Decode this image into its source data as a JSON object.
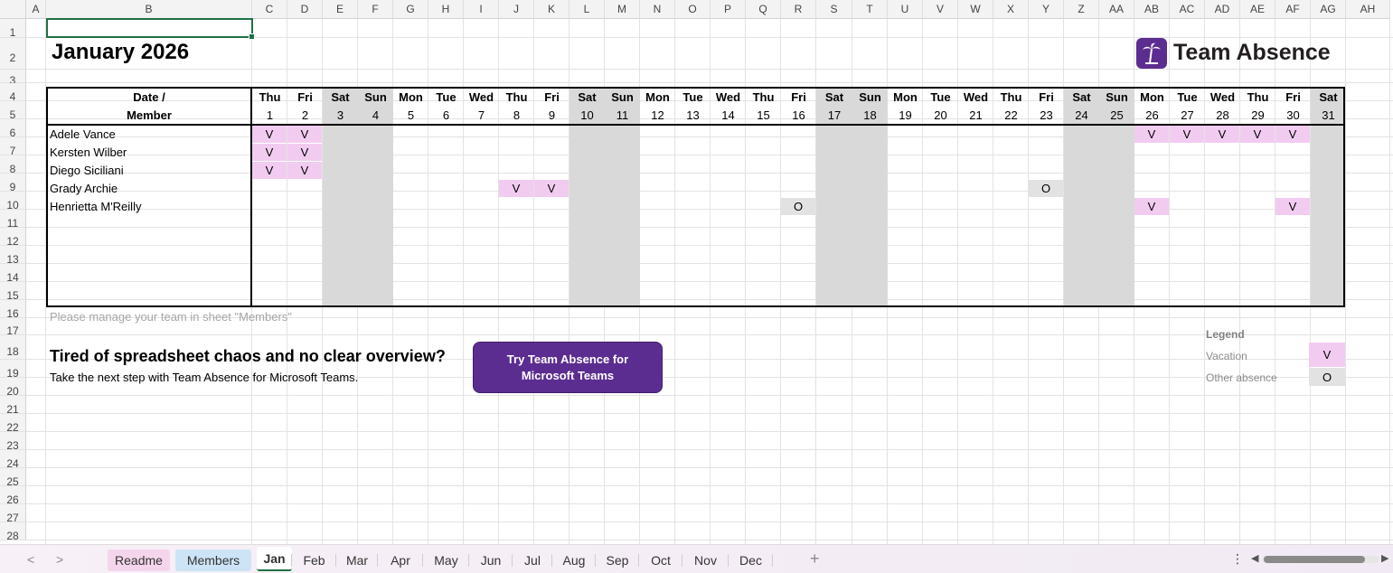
{
  "sheet": {
    "columns": [
      "A",
      "B",
      "C",
      "D",
      "E",
      "F",
      "G",
      "H",
      "I",
      "J",
      "K",
      "L",
      "M",
      "N",
      "O",
      "P",
      "Q",
      "R",
      "S",
      "T",
      "U",
      "V",
      "W",
      "X",
      "Y",
      "Z",
      "AA",
      "AB",
      "AC",
      "AD",
      "AE",
      "AF",
      "AG",
      "AH"
    ],
    "rows": [
      "1",
      "2",
      "3",
      "4",
      "5",
      "6",
      "7",
      "8",
      "9",
      "10",
      "11",
      "12",
      "13",
      "14",
      "15",
      "16",
      "17",
      "18",
      "19",
      "20",
      "21",
      "22",
      "23",
      "24",
      "25",
      "26",
      "27",
      "28"
    ]
  },
  "calendar": {
    "title": "January 2026",
    "header_date": "Date /",
    "header_member": "Member",
    "days": [
      {
        "dow": "Thu",
        "num": "1",
        "weekend": false
      },
      {
        "dow": "Fri",
        "num": "2",
        "weekend": false
      },
      {
        "dow": "Sat",
        "num": "3",
        "weekend": true
      },
      {
        "dow": "Sun",
        "num": "4",
        "weekend": true
      },
      {
        "dow": "Mon",
        "num": "5",
        "weekend": false
      },
      {
        "dow": "Tue",
        "num": "6",
        "weekend": false
      },
      {
        "dow": "Wed",
        "num": "7",
        "weekend": false
      },
      {
        "dow": "Thu",
        "num": "8",
        "weekend": false
      },
      {
        "dow": "Fri",
        "num": "9",
        "weekend": false
      },
      {
        "dow": "Sat",
        "num": "10",
        "weekend": true
      },
      {
        "dow": "Sun",
        "num": "11",
        "weekend": true
      },
      {
        "dow": "Mon",
        "num": "12",
        "weekend": false
      },
      {
        "dow": "Tue",
        "num": "13",
        "weekend": false
      },
      {
        "dow": "Wed",
        "num": "14",
        "weekend": false
      },
      {
        "dow": "Thu",
        "num": "15",
        "weekend": false
      },
      {
        "dow": "Fri",
        "num": "16",
        "weekend": false
      },
      {
        "dow": "Sat",
        "num": "17",
        "weekend": true
      },
      {
        "dow": "Sun",
        "num": "18",
        "weekend": true
      },
      {
        "dow": "Mon",
        "num": "19",
        "weekend": false
      },
      {
        "dow": "Tue",
        "num": "20",
        "weekend": false
      },
      {
        "dow": "Wed",
        "num": "21",
        "weekend": false
      },
      {
        "dow": "Thu",
        "num": "22",
        "weekend": false
      },
      {
        "dow": "Fri",
        "num": "23",
        "weekend": false
      },
      {
        "dow": "Sat",
        "num": "24",
        "weekend": true
      },
      {
        "dow": "Sun",
        "num": "25",
        "weekend": true
      },
      {
        "dow": "Mon",
        "num": "26",
        "weekend": false
      },
      {
        "dow": "Tue",
        "num": "27",
        "weekend": false
      },
      {
        "dow": "Wed",
        "num": "28",
        "weekend": false
      },
      {
        "dow": "Thu",
        "num": "29",
        "weekend": false
      },
      {
        "dow": "Fri",
        "num": "30",
        "weekend": false
      },
      {
        "dow": "Sat",
        "num": "31",
        "weekend": true
      }
    ],
    "members": [
      {
        "name": "Adele Vance",
        "absences": [
          {
            "day": "1",
            "type": "V"
          },
          {
            "day": "2",
            "type": "V"
          },
          {
            "day": "26",
            "type": "V"
          },
          {
            "day": "27",
            "type": "V"
          },
          {
            "day": "28",
            "type": "V"
          },
          {
            "day": "29",
            "type": "V"
          },
          {
            "day": "30",
            "type": "V"
          }
        ]
      },
      {
        "name": "Kersten Wilber",
        "absences": [
          {
            "day": "1",
            "type": "V"
          },
          {
            "day": "2",
            "type": "V"
          }
        ]
      },
      {
        "name": "Diego Siciliani",
        "absences": [
          {
            "day": "1",
            "type": "V"
          },
          {
            "day": "2",
            "type": "V"
          }
        ]
      },
      {
        "name": "Grady Archie",
        "absences": [
          {
            "day": "8",
            "type": "V"
          },
          {
            "day": "9",
            "type": "V"
          },
          {
            "day": "23",
            "type": "O"
          }
        ]
      },
      {
        "name": "Henrietta M'Reilly",
        "absences": [
          {
            "day": "16",
            "type": "O"
          },
          {
            "day": "26",
            "type": "V"
          },
          {
            "day": "30",
            "type": "V"
          }
        ]
      },
      {
        "name": "",
        "absences": []
      },
      {
        "name": "",
        "absences": []
      },
      {
        "name": "",
        "absences": []
      },
      {
        "name": "",
        "absences": []
      },
      {
        "name": "",
        "absences": []
      }
    ],
    "colors": {
      "vacation": "#f2ccf0",
      "other": "#e2e2e2",
      "weekend": "#d9d9d9"
    }
  },
  "brand": {
    "name": "Team Absence",
    "logo_icon": "palm-tree-icon",
    "color": "#5c2d91"
  },
  "note": "Please manage your team in sheet \"Members\"",
  "promo": {
    "title": "Tired of spreadsheet chaos and no clear overview?",
    "subtitle": "Take the next step with Team Absence for Microsoft Teams.",
    "cta": "Try Team Absence for Microsoft Teams"
  },
  "legend": {
    "title": "Legend",
    "items": [
      {
        "label": "Vacation",
        "code": "V"
      },
      {
        "label": "Other absence",
        "code": "O"
      }
    ]
  },
  "tabs": [
    {
      "label": "Readme",
      "style": "pink"
    },
    {
      "label": "Members",
      "style": "blue"
    },
    {
      "label": "Jan",
      "style": "active"
    },
    {
      "label": "Feb",
      "style": ""
    },
    {
      "label": "Mar",
      "style": ""
    },
    {
      "label": "Apr",
      "style": ""
    },
    {
      "label": "May",
      "style": ""
    },
    {
      "label": "Jun",
      "style": ""
    },
    {
      "label": "Jul",
      "style": ""
    },
    {
      "label": "Aug",
      "style": ""
    },
    {
      "label": "Sep",
      "style": ""
    },
    {
      "label": "Oct",
      "style": ""
    },
    {
      "label": "Nov",
      "style": ""
    },
    {
      "label": "Dec",
      "style": ""
    }
  ],
  "tabbar": {
    "prev": "<",
    "next": ">",
    "add": "+",
    "more": "⋮"
  }
}
